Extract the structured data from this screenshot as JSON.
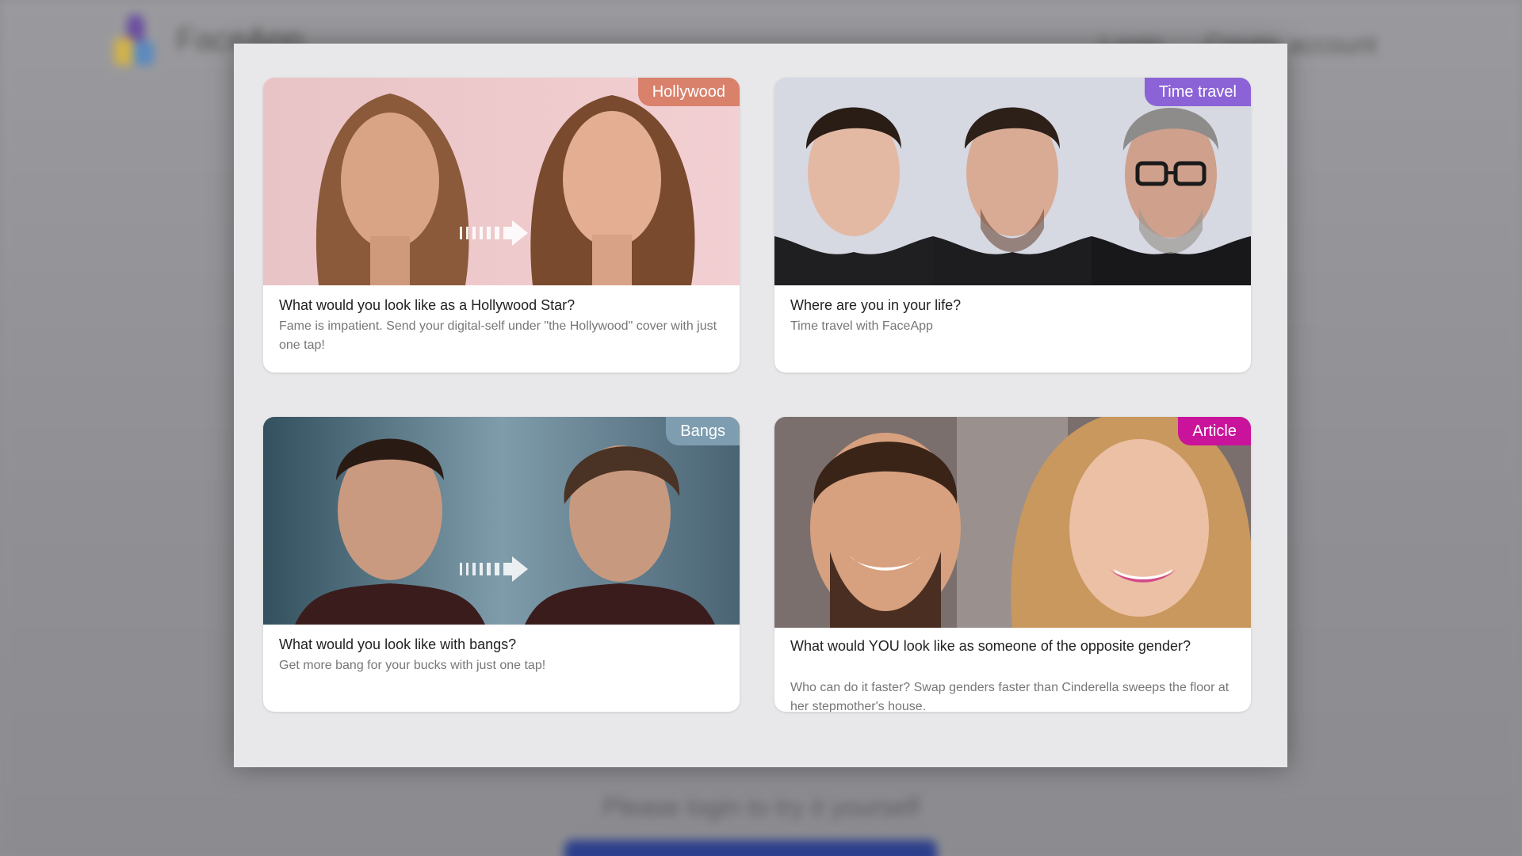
{
  "background": {
    "brand": "FaceApp",
    "nav": [
      "Login",
      "Create account"
    ],
    "login_prompt": "Please login to try it yourself"
  },
  "colors": {
    "hollywood": "#d9816b",
    "time_travel": "#8b63d6",
    "bangs": "#7e9db0",
    "article": "#c9139b"
  },
  "cards": [
    {
      "badge": "Hollywood",
      "title": "What would you look like as a Hollywood Star?",
      "desc": "Fame is impatient. Send your digital-self under \"the Hollywood\" cover with just one tap!"
    },
    {
      "badge": "Time travel",
      "title": "Where are you in your life?",
      "desc": "Time travel with FaceApp"
    },
    {
      "badge": "Bangs",
      "title": "What would you look like with bangs?",
      "desc": "Get more bang for your bucks with just one tap!"
    },
    {
      "badge": "Article",
      "title": "What would YOU look like as someone of the opposite gender?",
      "desc": "Who can do it faster? Swap genders faster than Cinderella sweeps the floor at her stepmother's house."
    }
  ]
}
